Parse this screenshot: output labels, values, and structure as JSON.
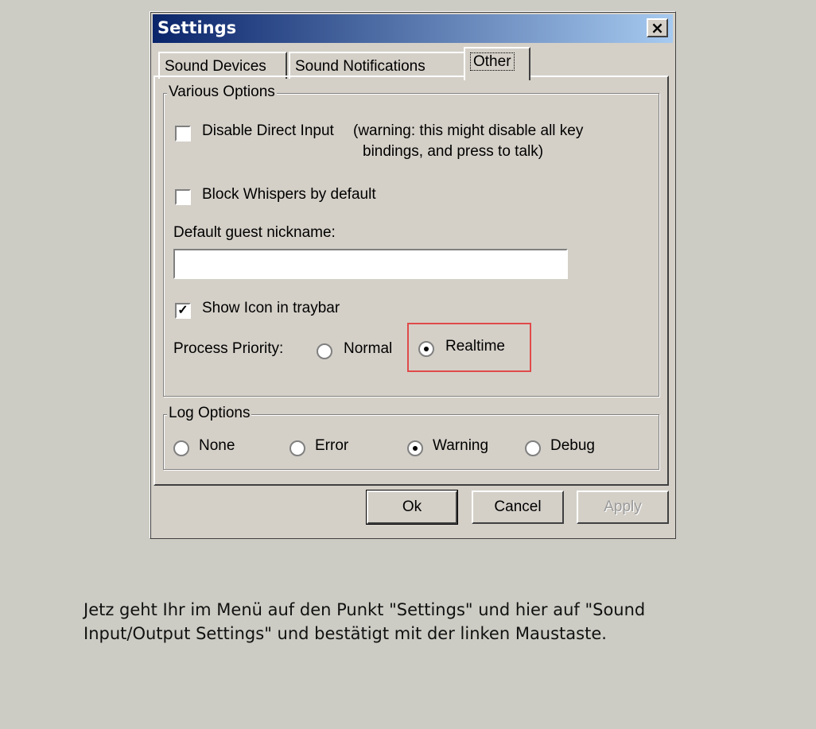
{
  "window": {
    "title": "Settings",
    "close_symbol": "×"
  },
  "tabs": [
    {
      "label": "Sound Devices",
      "active": false
    },
    {
      "label": "Sound Notifications",
      "active": false
    },
    {
      "label": "Other",
      "active": true
    }
  ],
  "various": {
    "title": "Various Options",
    "disable_direct_input": {
      "label": "Disable Direct Input",
      "checked": false
    },
    "warning_line1": "(warning: this might disable all key",
    "warning_line2": "bindings, and press to talk)",
    "block_whispers": {
      "label": "Block Whispers by default",
      "checked": false
    },
    "guest_nickname_label": "Default guest nickname:",
    "guest_nickname_value": "",
    "show_icon": {
      "label": "Show Icon in traybar",
      "checked": true,
      "mark": "✓"
    },
    "priority_label": "Process Priority:",
    "priority_normal": "Normal",
    "priority_realtime": "Realtime",
    "priority_selected": "Realtime"
  },
  "log": {
    "title": "Log Options",
    "none": "None",
    "error": "Error",
    "warning": "Warning",
    "debug": "Debug",
    "selected": "Warning"
  },
  "buttons": {
    "ok": "Ok",
    "cancel": "Cancel",
    "apply": "Apply"
  },
  "caption": {
    "line1": "Jetz geht Ihr im Menü auf den Punkt \"Settings\" und hier auf \"Sound",
    "line2": "Input/Output Settings\" und bestätigt mit der linken Maustaste."
  },
  "colors": {
    "highlight": "#e04a4a",
    "titlebar_start": "#0a246a",
    "titlebar_end": "#a6caf0"
  }
}
